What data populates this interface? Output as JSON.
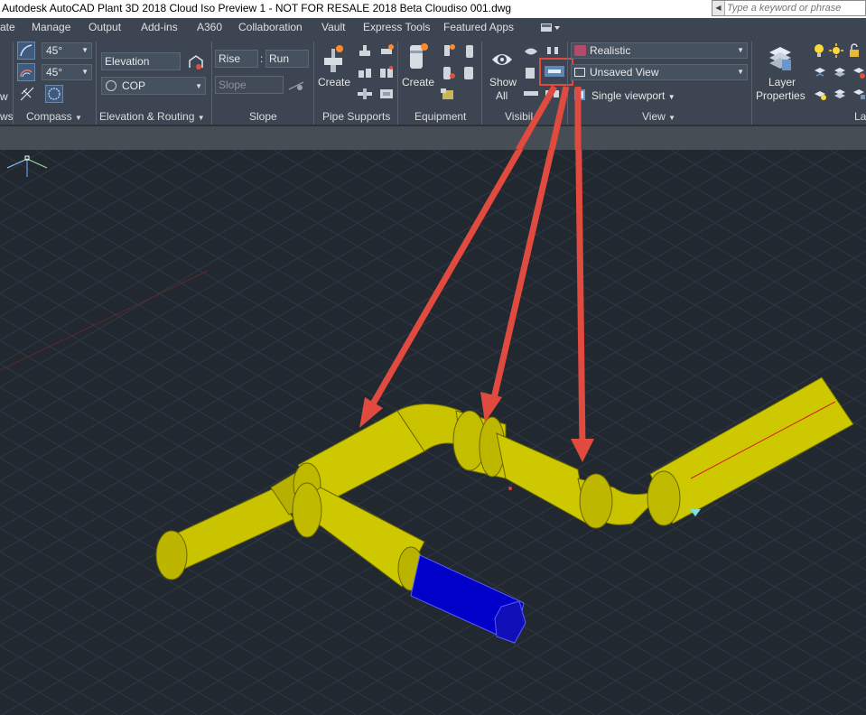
{
  "window": {
    "title": "Autodesk AutoCAD Plant 3D 2018 Cloud Iso Preview 1 - NOT FOR RESALE    2018 Beta Cloudiso 001.dwg",
    "search_placeholder": "Type a keyword or phrase"
  },
  "menu": [
    "ate",
    "Manage",
    "Output",
    "Add-ins",
    "A360",
    "Collaboration",
    "Vault",
    "Express Tools",
    "Featured Apps"
  ],
  "ribbon": {
    "compass": {
      "angle1": "45°",
      "angle2": "45°",
      "label": "Compass"
    },
    "elevation": {
      "field": "Elevation",
      "cop": "COP",
      "label": "Elevation & Routing"
    },
    "slope": {
      "rise": "Rise",
      "colon": ":",
      "run": "Run",
      "slope": "Slope",
      "label": "Slope"
    },
    "pipe_supports": {
      "create": "Create",
      "label": "Pipe Supports"
    },
    "equipment": {
      "create": "Create",
      "label": "Equipment"
    },
    "visibility": {
      "show_all_line1": "Show",
      "show_all_line2": "All",
      "label": "Visibil"
    },
    "view": {
      "visual_style": "Realistic",
      "named_view": "Unsaved View",
      "viewport": "Single viewport",
      "label": "View"
    },
    "layers": {
      "props_line1": "Layer",
      "props_line2": "Properties",
      "label": "Lay"
    },
    "left_cut_label": "ws",
    "left_cut_text": "w"
  },
  "colors": {
    "viewport_bg": "#212830",
    "pipe_yellow": "#c9c300",
    "pipe_blue": "#0000c8",
    "annotation_red": "#e04a3f"
  }
}
